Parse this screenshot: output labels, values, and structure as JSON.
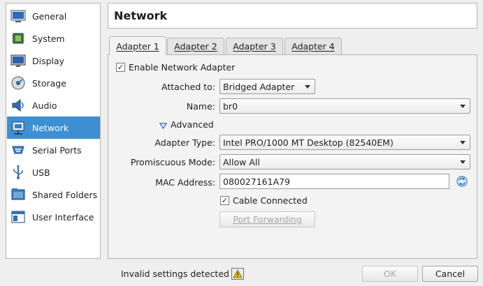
{
  "sidebar": {
    "items": [
      {
        "label": "General",
        "icon": "general-icon"
      },
      {
        "label": "System",
        "icon": "system-icon"
      },
      {
        "label": "Display",
        "icon": "display-icon"
      },
      {
        "label": "Storage",
        "icon": "storage-icon"
      },
      {
        "label": "Audio",
        "icon": "audio-icon"
      },
      {
        "label": "Network",
        "icon": "network-icon",
        "selected": true
      },
      {
        "label": "Serial Ports",
        "icon": "serial-ports-icon"
      },
      {
        "label": "USB",
        "icon": "usb-icon"
      },
      {
        "label": "Shared Folders",
        "icon": "shared-folders-icon"
      },
      {
        "label": "User Interface",
        "icon": "user-interface-icon"
      }
    ]
  },
  "header": {
    "title": "Network"
  },
  "tabs": [
    {
      "label": "Adapter 1",
      "active": true
    },
    {
      "label": "Adapter 2"
    },
    {
      "label": "Adapter 3"
    },
    {
      "label": "Adapter 4"
    }
  ],
  "adapter": {
    "enable_label": "Enable Network Adapter",
    "enable_checked": "✓",
    "attached_to_label": "Attached to:",
    "attached_to_value": "Bridged Adapter",
    "name_label": "Name:",
    "name_value": "br0",
    "advanced_label": "Advanced",
    "adapter_type_label": "Adapter Type:",
    "adapter_type_value": "Intel PRO/1000 MT Desktop (82540EM)",
    "promiscuous_label": "Promiscuous Mode:",
    "promiscuous_value": "Allow All",
    "mac_label": "MAC Address:",
    "mac_value": "080027161A79",
    "cable_label": "Cable Connected",
    "cable_checked": "✓",
    "port_forwarding_label": "Port Forwarding"
  },
  "footer": {
    "status_text": "Invalid settings detected",
    "ok_label": "OK",
    "cancel_label": "Cancel"
  },
  "colors": {
    "selection": "#3d8fd1",
    "accent_icon": "#2f7fc9"
  }
}
